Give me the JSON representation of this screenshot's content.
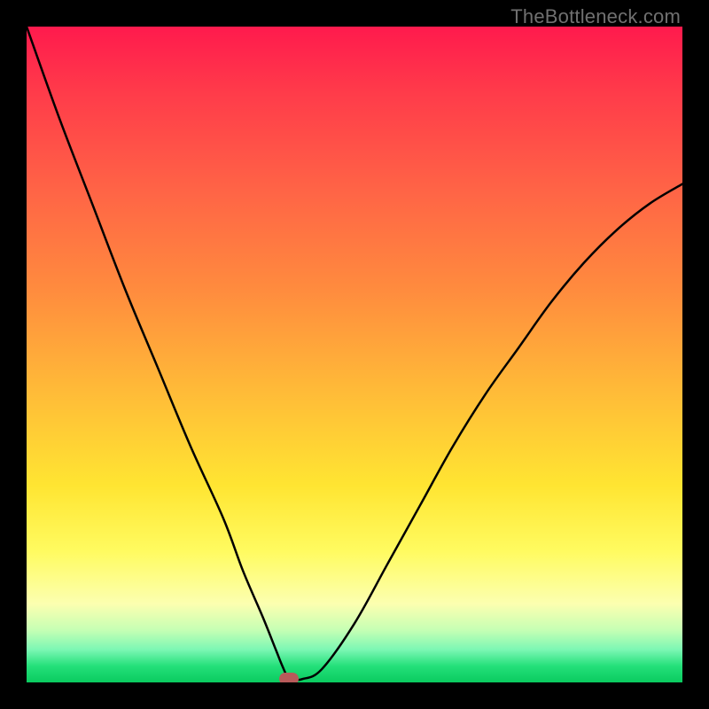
{
  "watermark": "TheBottleneck.com",
  "chart_data": {
    "type": "line",
    "title": "",
    "xlabel": "",
    "ylabel": "",
    "xlim": [
      0,
      100
    ],
    "ylim": [
      0,
      100
    ],
    "series": [
      {
        "name": "curve",
        "x": [
          0,
          5,
          10,
          15,
          20,
          25,
          30,
          33,
          36,
          38,
          39,
          40,
          41,
          42,
          45,
          50,
          55,
          60,
          65,
          70,
          75,
          80,
          85,
          90,
          95,
          100
        ],
        "values": [
          100,
          86,
          73,
          60,
          48,
          36,
          25,
          17,
          10,
          5,
          2.5,
          0.5,
          0.5,
          0.5,
          2,
          9,
          18,
          27,
          36,
          44,
          51,
          58,
          64,
          69,
          73,
          76
        ]
      }
    ],
    "marker": {
      "x": 40,
      "y": 0.5
    },
    "gradient_stops": [
      {
        "pos": 0,
        "color": "#ff1a4d"
      },
      {
        "pos": 0.25,
        "color": "#ff6446"
      },
      {
        "pos": 0.55,
        "color": "#ffb938"
      },
      {
        "pos": 0.8,
        "color": "#fffb60"
      },
      {
        "pos": 0.95,
        "color": "#7cf7b4"
      },
      {
        "pos": 1.0,
        "color": "#0acb5f"
      }
    ]
  }
}
